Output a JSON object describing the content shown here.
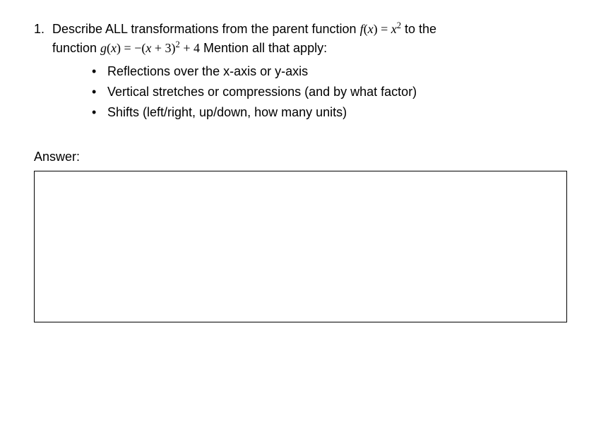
{
  "question": {
    "number": "1.",
    "prompt_part1": "Describe ALL transformations from the parent function ",
    "parent_fn_lhs": "f",
    "parent_fn_paren_open": "(",
    "parent_fn_arg": "x",
    "parent_fn_paren_close": ")",
    "parent_fn_eq": " = ",
    "parent_fn_rhs_base": "x",
    "parent_fn_rhs_exp": "2",
    "prompt_part2": "  to the",
    "prompt_line2a": "function ",
    "g_lhs": "g",
    "g_paren_open": "(",
    "g_arg": "x",
    "g_paren_close": ")",
    "g_eq": " = ",
    "g_neg": "−",
    "g_open": "(",
    "g_inner_x": "x",
    "g_inner_plus": " + 3",
    "g_close": ")",
    "g_exp": "2",
    "g_plus4": " + 4",
    "prompt_line2b": "  Mention all that apply:",
    "bullets": [
      "Reflections over the x-axis or y-axis",
      "Vertical stretches or compressions (and by what factor)",
      "Shifts (left/right, up/down, how many units)"
    ]
  },
  "answer": {
    "label": "Answer:",
    "value": ""
  }
}
